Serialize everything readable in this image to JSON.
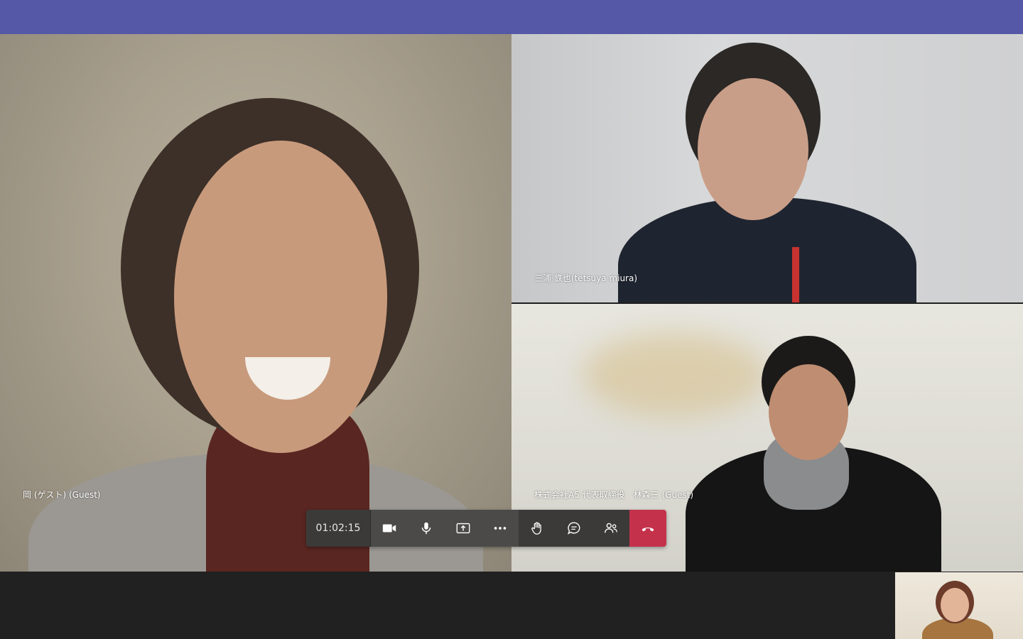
{
  "meeting": {
    "timer": "01:02:15",
    "participants": [
      {
        "name": "岡 (ゲスト) (Guest)"
      },
      {
        "name": "三浦 鉄也(tetsuya miura)"
      },
      {
        "name": "株式会社A5 代表取締役　林森三 (Guest)"
      }
    ]
  },
  "controls": [
    {
      "icon": "video-camera-icon"
    },
    {
      "icon": "microphone-icon"
    },
    {
      "icon": "share-screen-icon"
    },
    {
      "icon": "more-options-icon"
    },
    {
      "icon": "raise-hand-icon"
    },
    {
      "icon": "chat-icon"
    },
    {
      "icon": "participants-icon"
    },
    {
      "icon": "hang-up-icon"
    }
  ],
  "colors": {
    "topbar": "#5558a6",
    "hangup": "#c4314b",
    "toolbar": "#4b4a49"
  }
}
